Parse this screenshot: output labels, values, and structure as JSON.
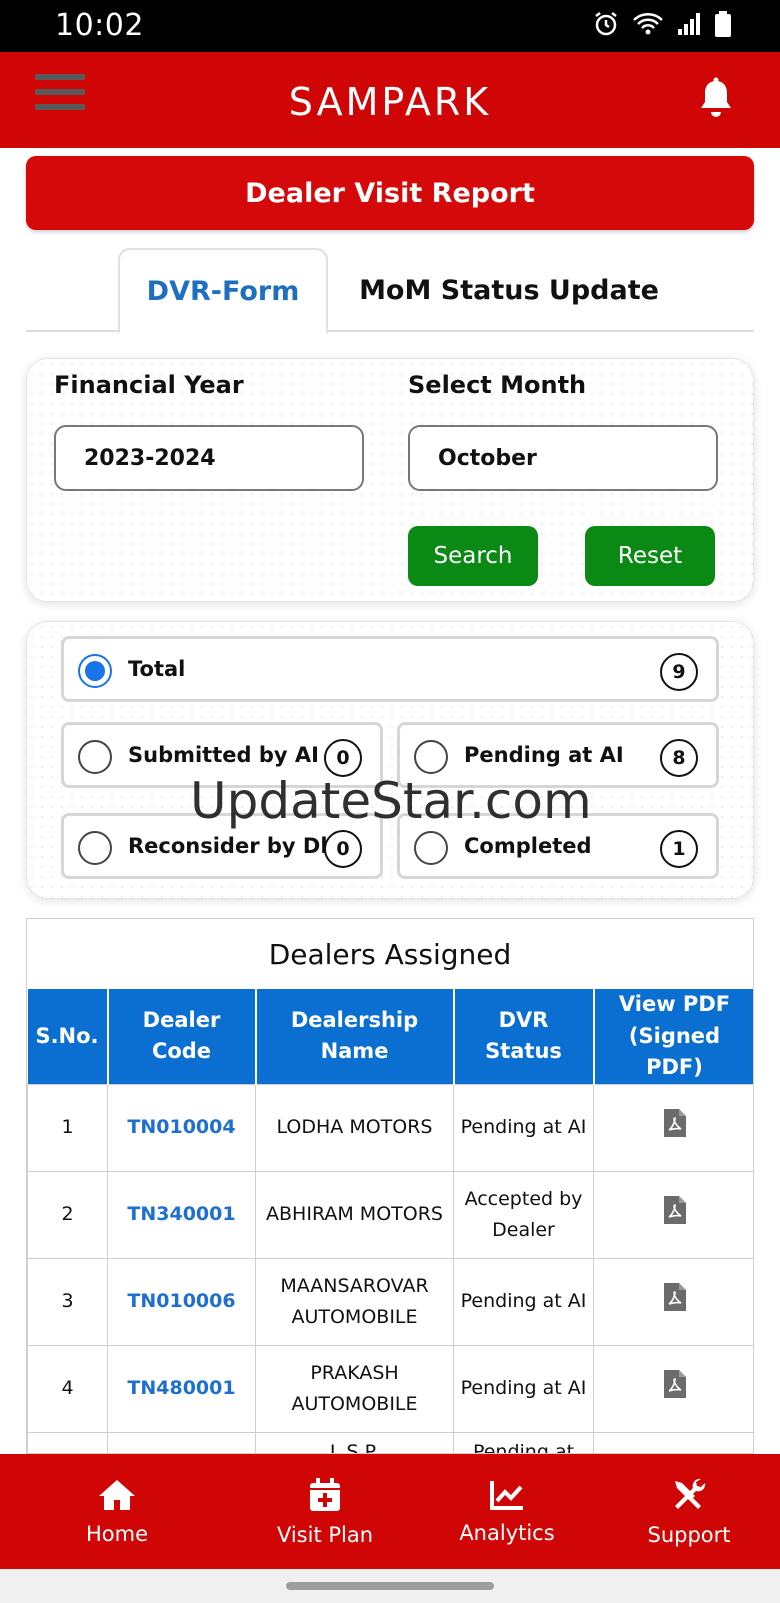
{
  "status_bar": {
    "time": "10:02"
  },
  "header": {
    "brand": "SAMPARK"
  },
  "page_title": "Dealer Visit Report",
  "tabs": [
    {
      "label": "DVR-Form",
      "active": true
    },
    {
      "label": "MoM Status Update",
      "active": false
    }
  ],
  "filters": {
    "financial_year_label": "Financial Year",
    "financial_year_value": "2023-2024",
    "month_label": "Select Month",
    "month_value": "October",
    "search_label": "Search",
    "reset_label": "Reset"
  },
  "status_filters": {
    "total": {
      "label": "Total",
      "count": "9",
      "selected": true
    },
    "submitted": {
      "label": "Submitted by AI",
      "count": "0"
    },
    "pending": {
      "label": "Pending at AI",
      "count": "8"
    },
    "reconsider": {
      "label": "Reconsider by Dlr",
      "count": "0"
    },
    "completed": {
      "label": "Completed",
      "count": "1"
    }
  },
  "watermark": "UpdateStar.com",
  "dealers_table": {
    "title": "Dealers Assigned",
    "columns": [
      "S.No.",
      "Dealer Code",
      "Dealership Name",
      "DVR Status",
      "View PDF (Signed PDF)"
    ],
    "rows": [
      {
        "sno": "1",
        "code": "TN010004",
        "name": "LODHA MOTORS",
        "status": "Pending at AI"
      },
      {
        "sno": "2",
        "code": "TN340001",
        "name": "ABHIRAM MOTORS",
        "status": "Accepted by Dealer"
      },
      {
        "sno": "3",
        "code": "TN010006",
        "name": "MAANSAROVAR AUTOMOBILE",
        "status": "Pending at AI"
      },
      {
        "sno": "4",
        "code": "TN480001",
        "name": "PRAKASH AUTOMOBILE",
        "status": "Pending at AI"
      },
      {
        "sno": "",
        "code": "",
        "name": "L.S.P.",
        "status": "Pending at"
      }
    ]
  },
  "bottom_nav": [
    {
      "label": "Home",
      "icon": "home-icon"
    },
    {
      "label": "Visit Plan",
      "icon": "calendar-plus-icon"
    },
    {
      "label": "Analytics",
      "icon": "chart-line-icon"
    },
    {
      "label": "Support",
      "icon": "tools-icon"
    }
  ],
  "colors": {
    "primary_red": "#d00606",
    "table_header_blue": "#0a6fd1",
    "button_green": "#0a8a14",
    "link_blue": "#1e6fd1"
  }
}
